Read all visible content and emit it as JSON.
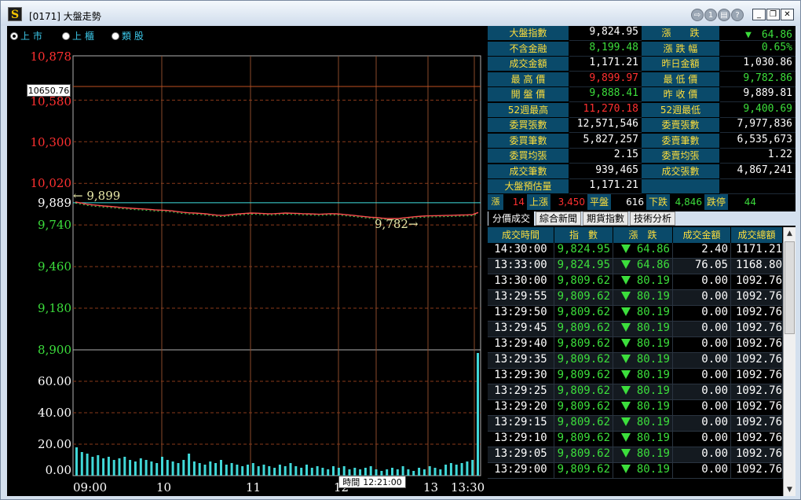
{
  "window": {
    "title": "[0171] 大盤走勢",
    "app_icon": "S"
  },
  "radios": [
    {
      "label": "上 市",
      "checked": true
    },
    {
      "label": "上 櫃",
      "checked": false
    },
    {
      "label": "類 股",
      "checked": false
    }
  ],
  "chart_data": {
    "type": "line",
    "title": "",
    "y_ticks_price": [
      "10,878",
      "10,580",
      "10,300",
      "10,020",
      "9,889",
      "9,740",
      "9,460",
      "9,180",
      "8,900"
    ],
    "y_ticks_volume": [
      "60.00",
      "40.00",
      "20.00",
      "0.00"
    ],
    "x_ticks": [
      "09:00",
      "10",
      "11",
      "12",
      "13",
      "13:30"
    ],
    "reference_close": 9889.81,
    "high_label": "9,899",
    "low_label": "9,782",
    "cursor_value": "10650.76",
    "cursor_time_label": "時間",
    "cursor_time": "12:21:00",
    "ylim_price": [
      8900,
      10878
    ],
    "ylim_volume": [
      0,
      80
    ],
    "series": [
      {
        "values": [
          9895,
          9888,
          9880,
          9875,
          9872,
          9868,
          9865,
          9862,
          9858,
          9855,
          9852,
          9850,
          9848,
          9845,
          9842,
          9840,
          9838,
          9835,
          9830,
          9825,
          9822,
          9820,
          9818,
          9815,
          9810,
          9806,
          9804,
          9808,
          9812,
          9815,
          9818,
          9820,
          9819,
          9817,
          9815,
          9816,
          9818,
          9820,
          9819,
          9818,
          9816,
          9815,
          9814,
          9812,
          9814,
          9816,
          9815,
          9812,
          9808,
          9805,
          9800,
          9796,
          9792,
          9790,
          9786,
          9784,
          9783,
          9784,
          9788,
          9792,
          9796,
          9799,
          9801,
          9802,
          9803,
          9804,
          9805,
          9806,
          9807,
          9808,
          9810,
          9824
        ]
      }
    ],
    "volume": [
      18,
      15,
      14,
      12,
      13,
      11,
      12,
      10,
      11,
      12,
      10,
      9,
      11,
      10,
      9,
      8,
      12,
      10,
      9,
      8,
      10,
      14,
      9,
      8,
      7,
      9,
      8,
      10,
      7,
      8,
      7,
      6,
      7,
      8,
      6,
      7,
      6,
      5,
      7,
      6,
      8,
      6,
      5,
      7,
      5,
      6,
      5,
      4,
      6,
      5,
      6,
      4,
      5,
      4,
      5,
      6,
      4,
      3,
      4,
      5,
      4,
      6,
      4,
      3,
      5,
      4,
      6,
      5,
      4,
      7,
      8,
      7,
      8,
      9,
      10,
      78
    ]
  },
  "stats": [
    {
      "l1": "大盤指數",
      "v1": "9,824.95",
      "c1": "white",
      "l2": "漲　　跌",
      "v2": "▼　64.86",
      "c2": "green"
    },
    {
      "l1": "不含金融",
      "v1": "8,199.48",
      "c1": "green",
      "l2": "漲 跌 幅",
      "v2": "0.65%",
      "c2": "green"
    },
    {
      "l1": "成交金額",
      "v1": "1,171.21",
      "c1": "white",
      "l2": "昨日金額",
      "v2": "1,030.86",
      "c2": "white"
    },
    {
      "l1": "最 高 價",
      "v1": "9,899.97",
      "c1": "red",
      "l2": "最 低 價",
      "v2": "9,782.86",
      "c2": "green"
    },
    {
      "l1": "開 盤 價",
      "v1": "9,888.41",
      "c1": "green",
      "l2": "昨 收 價",
      "v2": "9,889.81",
      "c2": "white"
    },
    {
      "l1": "52週最高",
      "v1": "11,270.18",
      "c1": "red",
      "l2": "52週最低",
      "v2": "9,400.69",
      "c2": "green"
    },
    {
      "l1": "委買張數",
      "v1": "12,571,546",
      "c1": "white",
      "l2": "委賣張數",
      "v2": "7,977,836",
      "c2": "white"
    },
    {
      "l1": "委買筆數",
      "v1": "5,827,257",
      "c1": "white",
      "l2": "委賣筆數",
      "v2": "6,535,673",
      "c2": "white"
    },
    {
      "l1": "委買均張",
      "v1": "2.15",
      "c1": "white",
      "l2": "委賣均張",
      "v2": "1.22",
      "c2": "white"
    },
    {
      "l1": "成交筆數",
      "v1": "939,465",
      "c1": "white",
      "l2": "成交張數",
      "v2": "4,867,241",
      "c2": "white"
    },
    {
      "l1": "大盤預估量",
      "v1": "1,171.21",
      "c1": "white",
      "l2": "",
      "v2": "",
      "c2": "white"
    }
  ],
  "breadth": {
    "limit_up_label": "漲停",
    "limit_up": "14",
    "up_label": "上漲",
    "up": "3,450",
    "flat_label": "平盤",
    "flat": "616",
    "down_label": "下跌",
    "down": "4,846",
    "limit_down_label": "跌停",
    "limit_down": "44"
  },
  "tabs": [
    "分價成交",
    "綜合新聞",
    "期貨指數",
    "技術分析"
  ],
  "table": {
    "headers": [
      "成交時間",
      "指　數",
      "漲　跌",
      "成交金額",
      "成交總額"
    ],
    "rows": [
      [
        "14:30:00",
        "9,824.95",
        "64.86",
        "2.40",
        "1171.21"
      ],
      [
        "13:33:00",
        "9,824.95",
        "64.86",
        "76.05",
        "1168.80"
      ],
      [
        "13:30:00",
        "9,809.62",
        "80.19",
        "0.00",
        "1092.76"
      ],
      [
        "13:29:55",
        "9,809.62",
        "80.19",
        "0.00",
        "1092.76"
      ],
      [
        "13:29:50",
        "9,809.62",
        "80.19",
        "0.00",
        "1092.76"
      ],
      [
        "13:29:45",
        "9,809.62",
        "80.19",
        "0.00",
        "1092.76"
      ],
      [
        "13:29:40",
        "9,809.62",
        "80.19",
        "0.00",
        "1092.76"
      ],
      [
        "13:29:35",
        "9,809.62",
        "80.19",
        "0.00",
        "1092.76"
      ],
      [
        "13:29:30",
        "9,809.62",
        "80.19",
        "0.00",
        "1092.76"
      ],
      [
        "13:29:25",
        "9,809.62",
        "80.19",
        "0.00",
        "1092.76"
      ],
      [
        "13:29:20",
        "9,809.62",
        "80.19",
        "0.00",
        "1092.76"
      ],
      [
        "13:29:15",
        "9,809.62",
        "80.19",
        "0.00",
        "1092.76"
      ],
      [
        "13:29:10",
        "9,809.62",
        "80.19",
        "0.00",
        "1092.76"
      ],
      [
        "13:29:05",
        "9,809.62",
        "80.19",
        "0.00",
        "1092.76"
      ],
      [
        "13:29:00",
        "9,809.62",
        "80.19",
        "0.00",
        "1092.76"
      ]
    ]
  }
}
